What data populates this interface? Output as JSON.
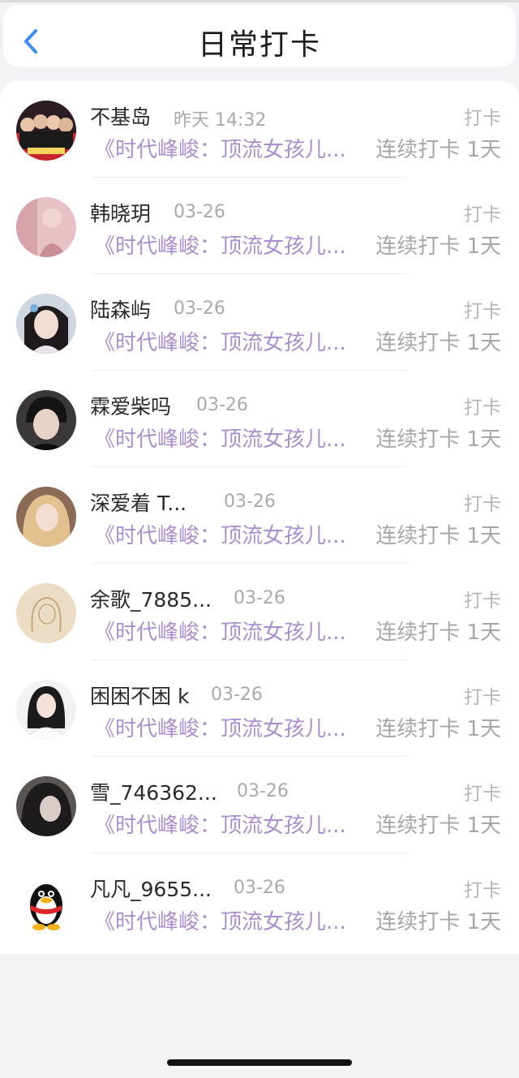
{
  "header": {
    "title": "日常打卡"
  },
  "items": [
    {
      "name": "不基岛",
      "date": "昨天 14:32",
      "tag": "打卡",
      "book": "《时代峰峻：顶流女孩儿...",
      "streak": "连续打卡 1天",
      "avatar_icon": "group-photo-avatar"
    },
    {
      "name": "韩晓玥",
      "date": "03-26",
      "tag": "打卡",
      "book": "《时代峰峻：顶流女孩儿...",
      "streak": "连续打卡 1天",
      "avatar_icon": "pink-portrait-avatar"
    },
    {
      "name": "陆森屿",
      "date": "03-26",
      "tag": "打卡",
      "book": "《时代峰峻：顶流女孩儿...",
      "streak": "连续打卡 1天",
      "avatar_icon": "girl-portrait-avatar"
    },
    {
      "name": "霖爱柴吗",
      "date": "03-26",
      "tag": "打卡",
      "book": "《时代峰峻：顶流女孩儿...",
      "streak": "连续打卡 1天",
      "avatar_icon": "boy-portrait-avatar"
    },
    {
      "name": "深爱着 T...",
      "date": "03-26",
      "tag": "打卡",
      "book": "《时代峰峻：顶流女孩儿...",
      "streak": "连续打卡 1天",
      "avatar_icon": "blonde-portrait-avatar"
    },
    {
      "name": "余歌_7885...",
      "date": "03-26",
      "tag": "打卡",
      "book": "《时代峰峻：顶流女孩儿...",
      "streak": "连续打卡 1天",
      "avatar_icon": "sketch-girl-avatar"
    },
    {
      "name": "困困不困 k",
      "date": "03-26",
      "tag": "打卡",
      "book": "《时代峰峻：顶流女孩儿...",
      "streak": "连续打卡 1天",
      "avatar_icon": "girl-white-shirt-avatar"
    },
    {
      "name": "雪_746362...",
      "date": "03-26",
      "tag": "打卡",
      "book": "《时代峰峻：顶流女孩儿...",
      "streak": "连续打卡 1天",
      "avatar_icon": "dark-portrait-avatar"
    },
    {
      "name": "凡凡_9655...",
      "date": "03-26",
      "tag": "打卡",
      "book": "《时代峰峻：顶流女孩儿...",
      "streak": "连续打卡 1天",
      "avatar_icon": "qq-penguin-avatar"
    }
  ],
  "colors": {
    "accent": "#3c8df5",
    "book": "#a98fce",
    "muted": "#a7a7a7"
  }
}
